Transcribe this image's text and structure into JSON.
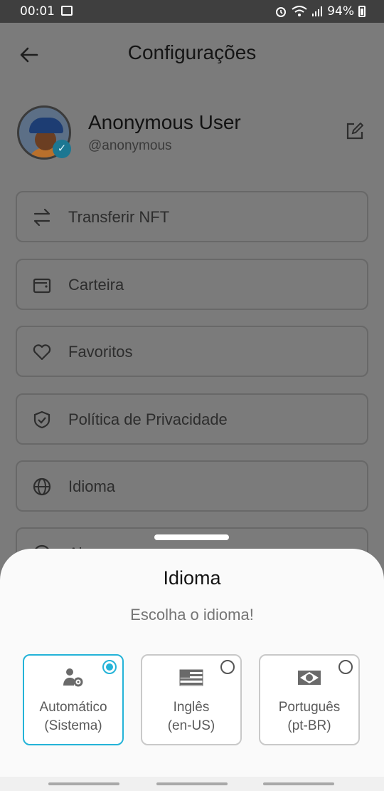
{
  "status": {
    "time": "00:01",
    "battery": "94%"
  },
  "header": {
    "title": "Configurações"
  },
  "profile": {
    "name": "Anonymous User",
    "handle": "@anonymous"
  },
  "menu": [
    {
      "label": "Transferir NFT",
      "icon": "transfer-icon"
    },
    {
      "label": "Carteira",
      "icon": "wallet-icon"
    },
    {
      "label": "Favoritos",
      "icon": "heart-icon"
    },
    {
      "label": "Política de Privacidade",
      "icon": "shield-icon"
    },
    {
      "label": "Idioma",
      "icon": "globe-icon"
    },
    {
      "label": "Aj",
      "icon": "help-icon"
    }
  ],
  "sheet": {
    "title": "Idioma",
    "subtitle": "Escolha o idioma!",
    "options": [
      {
        "line1": "Automático",
        "line2": "(Sistema)",
        "selected": true,
        "icon": "user-gear-icon"
      },
      {
        "line1": "Inglês",
        "line2": "(en-US)",
        "selected": false,
        "icon": "us-flag-icon"
      },
      {
        "line1": "Português",
        "line2": "(pt-BR)",
        "selected": false,
        "icon": "brazil-flag-icon"
      }
    ]
  },
  "colors": {
    "accent": "#24b3d8",
    "overlay": "#7b7b7b"
  }
}
